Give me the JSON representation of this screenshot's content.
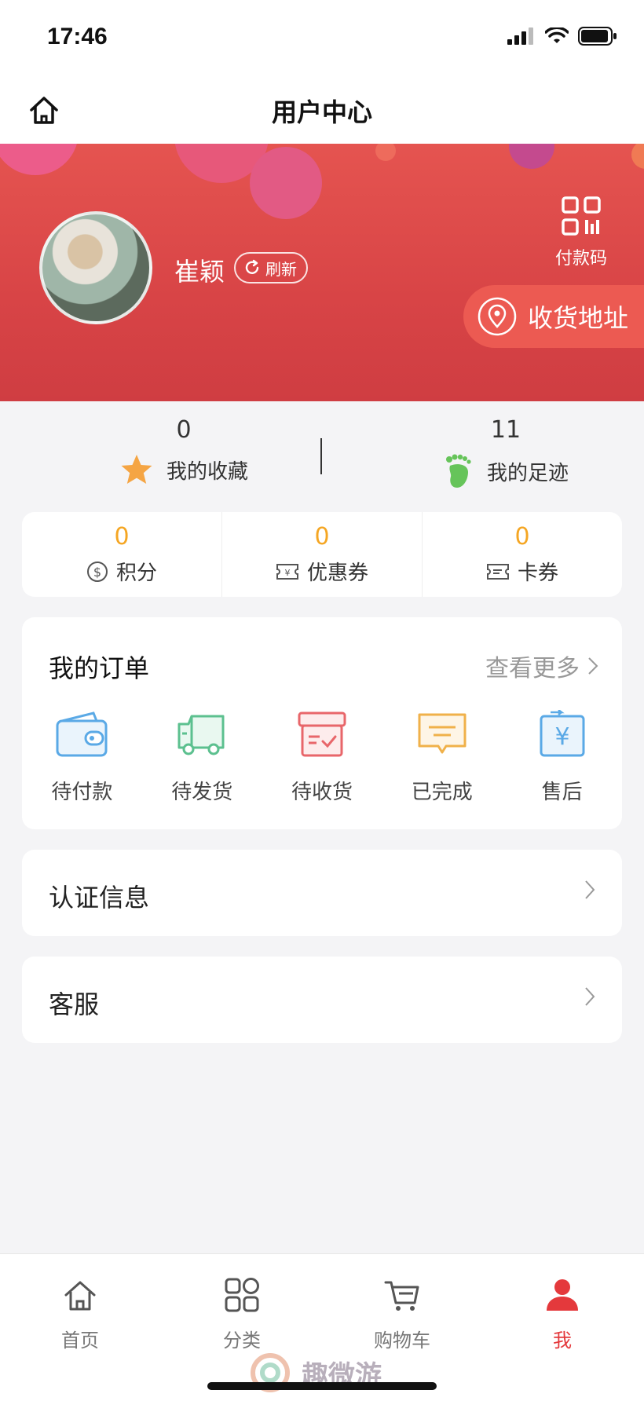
{
  "status_bar": {
    "time": "17:46"
  },
  "nav": {
    "title": "用户中心"
  },
  "profile": {
    "user_name": "崔颖",
    "refresh_label": "刷新",
    "paycode_label": "付款码",
    "address_label": "收货地址"
  },
  "stats": [
    {
      "value": "0",
      "label": "我的收藏",
      "icon": "star-icon"
    },
    {
      "value": "11",
      "label": "我的足迹",
      "icon": "footprint-icon"
    }
  ],
  "points": [
    {
      "value": "0",
      "label": "积分",
      "icon": "dollar-coin-icon"
    },
    {
      "value": "0",
      "label": "优惠券",
      "icon": "coupon-icon"
    },
    {
      "value": "0",
      "label": "卡券",
      "icon": "ticket-icon"
    }
  ],
  "orders": {
    "title": "我的订单",
    "more_label": "查看更多",
    "items": [
      {
        "label": "待付款",
        "icon": "wallet-icon",
        "color": "#5aa9e6"
      },
      {
        "label": "待发货",
        "icon": "truck-icon",
        "color": "#5cc08f"
      },
      {
        "label": "待收货",
        "icon": "box-icon",
        "color": "#e8666a"
      },
      {
        "label": "已完成",
        "icon": "message-icon",
        "color": "#f0b14a"
      },
      {
        "label": "售后",
        "icon": "yuan-exchange-icon",
        "color": "#5aa9e6"
      }
    ]
  },
  "menu": {
    "certification_label": "认证信息",
    "service_label": "客服"
  },
  "tabs": [
    {
      "label": "首页",
      "icon": "home-icon"
    },
    {
      "label": "分类",
      "icon": "category-icon"
    },
    {
      "label": "购物车",
      "icon": "cart-icon"
    },
    {
      "label": "我",
      "icon": "user-icon",
      "active": true
    }
  ],
  "watermark": {
    "text": "趣微游"
  },
  "colors": {
    "brand_red": "#d84446",
    "accent": "#e4393c",
    "points_orange": "#f5a623"
  }
}
